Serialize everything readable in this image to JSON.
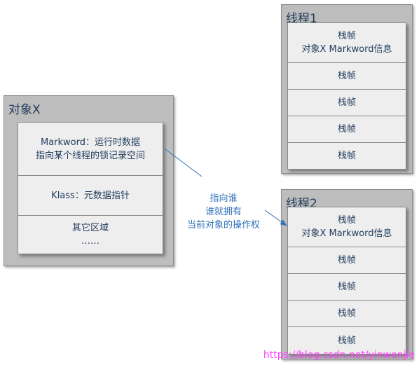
{
  "object_x": {
    "title": "对象X",
    "markword_line1": "Markword：运行时数据",
    "markword_line2": "指向某个线程的锁记录空间",
    "klass": "Klass：元数据指针",
    "other_line1": "其它区域",
    "other_line2": "……"
  },
  "thread1": {
    "title": "线程1",
    "frame_top_line1": "栈帧",
    "frame_top_line2": "对象X Markword信息",
    "frames": [
      "栈帧",
      "栈帧",
      "栈帧",
      "栈帧"
    ]
  },
  "thread2": {
    "title": "线程2",
    "frame_top_line1": "栈帧",
    "frame_top_line2": "对象X Markword信息",
    "frames": [
      "栈帧",
      "栈帧",
      "栈帧",
      "栈帧"
    ]
  },
  "connector": {
    "line1": "指向谁",
    "line2": "谁就拥有",
    "line3": "当前对象的操作权",
    "color": "#2f73b8"
  },
  "watermark": "https://blog.csdn.net/yinwenjie"
}
